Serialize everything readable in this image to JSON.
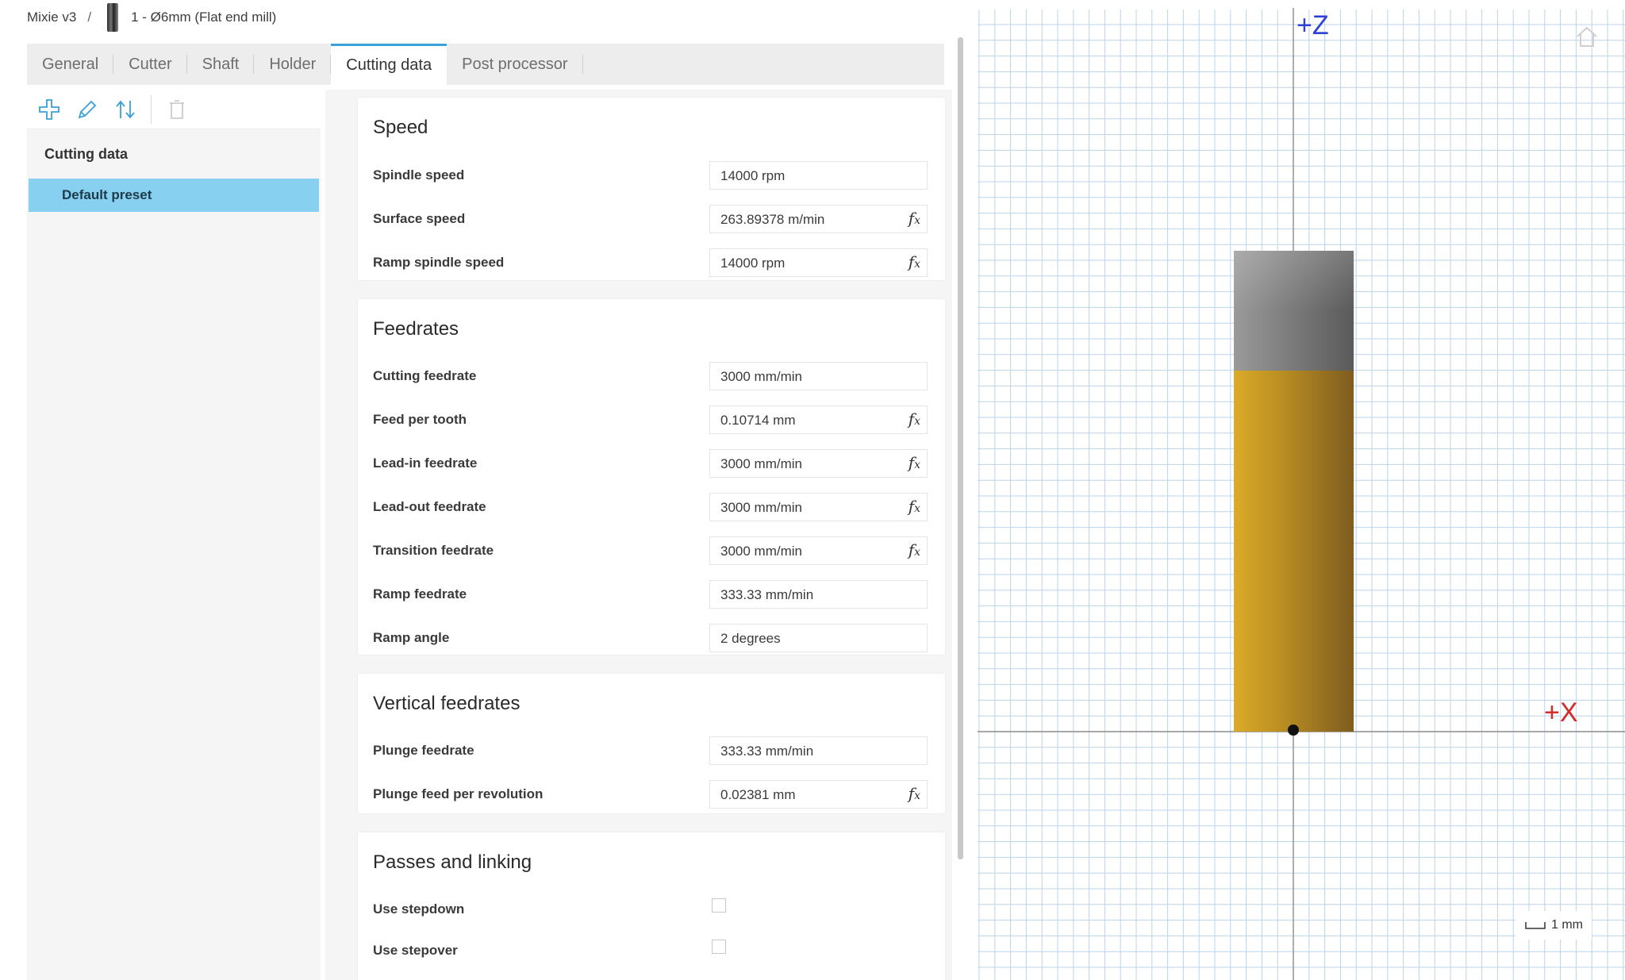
{
  "breadcrumb": {
    "library": "Mixie v3",
    "separator": "/",
    "tool": "1 - Ø6mm (Flat end mill)"
  },
  "tabs": [
    {
      "label": "General",
      "active": false
    },
    {
      "label": "Cutter",
      "active": false
    },
    {
      "label": "Shaft",
      "active": false
    },
    {
      "label": "Holder",
      "active": false
    },
    {
      "label": "Cutting data",
      "active": true
    },
    {
      "label": "Post processor",
      "active": false
    }
  ],
  "left_panel": {
    "toolbar_icons": [
      "add-icon",
      "edit-icon",
      "sort-icon",
      "delete-icon"
    ],
    "heading": "Cutting data",
    "selected_preset": "Default preset"
  },
  "sections": {
    "speed": {
      "title": "Speed",
      "rows": [
        {
          "label": "Spindle speed",
          "value": "14000 rpm",
          "fx": false
        },
        {
          "label": "Surface speed",
          "value": "263.89378 m/min",
          "fx": true
        },
        {
          "label": "Ramp spindle speed",
          "value": "14000 rpm",
          "fx": true
        }
      ]
    },
    "feedrates": {
      "title": "Feedrates",
      "rows": [
        {
          "label": "Cutting feedrate",
          "value": "3000 mm/min",
          "fx": false
        },
        {
          "label": "Feed per tooth",
          "value": "0.10714 mm",
          "fx": true
        },
        {
          "label": "Lead-in feedrate",
          "value": "3000 mm/min",
          "fx": true
        },
        {
          "label": "Lead-out feedrate",
          "value": "3000 mm/min",
          "fx": true
        },
        {
          "label": "Transition feedrate",
          "value": "3000 mm/min",
          "fx": true
        },
        {
          "label": "Ramp feedrate",
          "value": "333.33 mm/min",
          "fx": false
        },
        {
          "label": "Ramp angle",
          "value": "2 degrees",
          "fx": false
        }
      ]
    },
    "vertical_feedrates": {
      "title": "Vertical feedrates",
      "rows": [
        {
          "label": "Plunge feedrate",
          "value": "333.33 mm/min",
          "fx": false
        },
        {
          "label": "Plunge feed per revolution",
          "value": "0.02381 mm",
          "fx": true
        }
      ]
    },
    "passes": {
      "title": "Passes and linking",
      "rows": [
        {
          "label": "Use stepdown",
          "checked": false
        },
        {
          "label": "Use stepover",
          "checked": false
        }
      ]
    }
  },
  "fx_symbol": {
    "f": "f",
    "x": "x"
  },
  "viewport": {
    "z_axis_label": "+Z",
    "x_axis_label": "+X",
    "scale_label": "1 mm",
    "home_icon": "home-icon",
    "colors": {
      "grid": "#bcd3ec",
      "axis": "#8a8a8a",
      "z_label": "#2e3fd6",
      "x_label": "#d42a2a",
      "holder": "#7a7a7a",
      "flute": "#c8961e"
    }
  }
}
